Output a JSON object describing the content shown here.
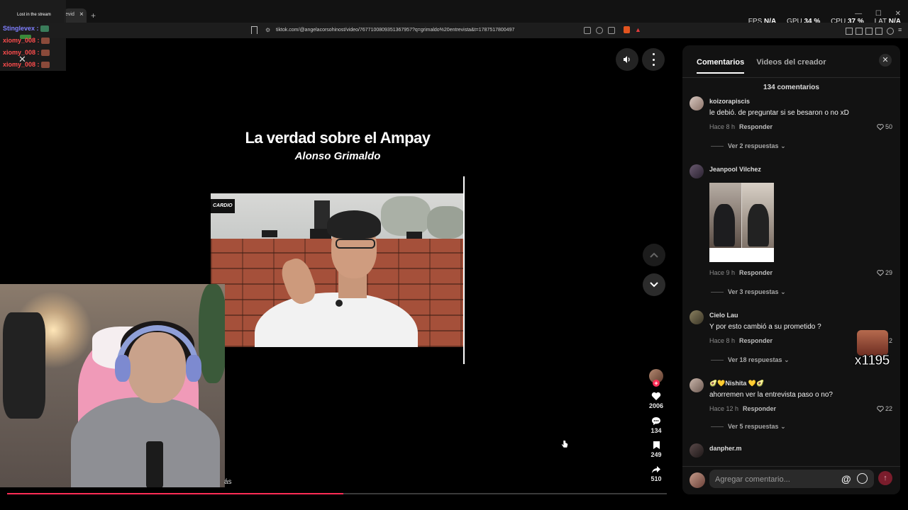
{
  "browser": {
    "tab_title": "evid",
    "url": "tiktok.com/@angelacorsohinost/video/7677100809351367957?q=grimaldo%20entrevista&t=1787517800497",
    "stats": [
      {
        "label": "FPS",
        "value": "N/A"
      },
      {
        "label": "GPU",
        "value": "34 %"
      },
      {
        "label": "CPU",
        "value": "37 %"
      },
      {
        "label": "LAT",
        "value": "N/A"
      }
    ]
  },
  "stream_chat": {
    "header": "Lost in the stream",
    "lines": [
      {
        "user": "Stinglevex :",
        "color": "#7f7fff"
      },
      {
        "user": "xiomy_008 :",
        "color": "#ff4d4d"
      },
      {
        "user": "xiomy_008 :",
        "color": "#ff4d4d"
      },
      {
        "user": "xiomy_008 :",
        "color": "#ff4d4d"
      }
    ]
  },
  "video": {
    "title": "La verdad sobre el Ampay",
    "subtitle": "Alonso Grimaldo",
    "logo_text": "CARDIO",
    "more_text": "ás",
    "progress": 0.51
  },
  "actions": {
    "likes": "2006",
    "comments": "134",
    "saves": "249",
    "shares": "510"
  },
  "comments_panel": {
    "tabs": [
      "Comentarios",
      "Videos del creador"
    ],
    "count_label": "134 comentarios",
    "reply_label": "Responder",
    "comments": [
      {
        "user": "koizorapiscis",
        "text": "le debió. de preguntar si se besaron o no xD",
        "time": "Hace 8 h",
        "likes": "50",
        "more": "Ver 2 respuestas"
      },
      {
        "user": "Jeanpool Vilchez",
        "text": "",
        "time": "Hace 9 h",
        "likes": "29",
        "more": "Ver 3 respuestas"
      },
      {
        "user": "Cielo Lau",
        "text": "Y por esto cambió a su prometido ?",
        "time": "Hace 8 h",
        "likes": "2",
        "more": "Ver 18 respuestas"
      },
      {
        "user": "🥑💛Nishita 💛🥑",
        "text": "ahorremen ver la entrevista paso o no?",
        "time": "Hace 12 h",
        "likes": "22",
        "more": "Ver 5 respuestas"
      },
      {
        "user": "danpher.m",
        "text": "",
        "time": "",
        "likes": "",
        "more": ""
      }
    ],
    "input_placeholder": "Agregar comentario..."
  },
  "emote_text": "x1195"
}
